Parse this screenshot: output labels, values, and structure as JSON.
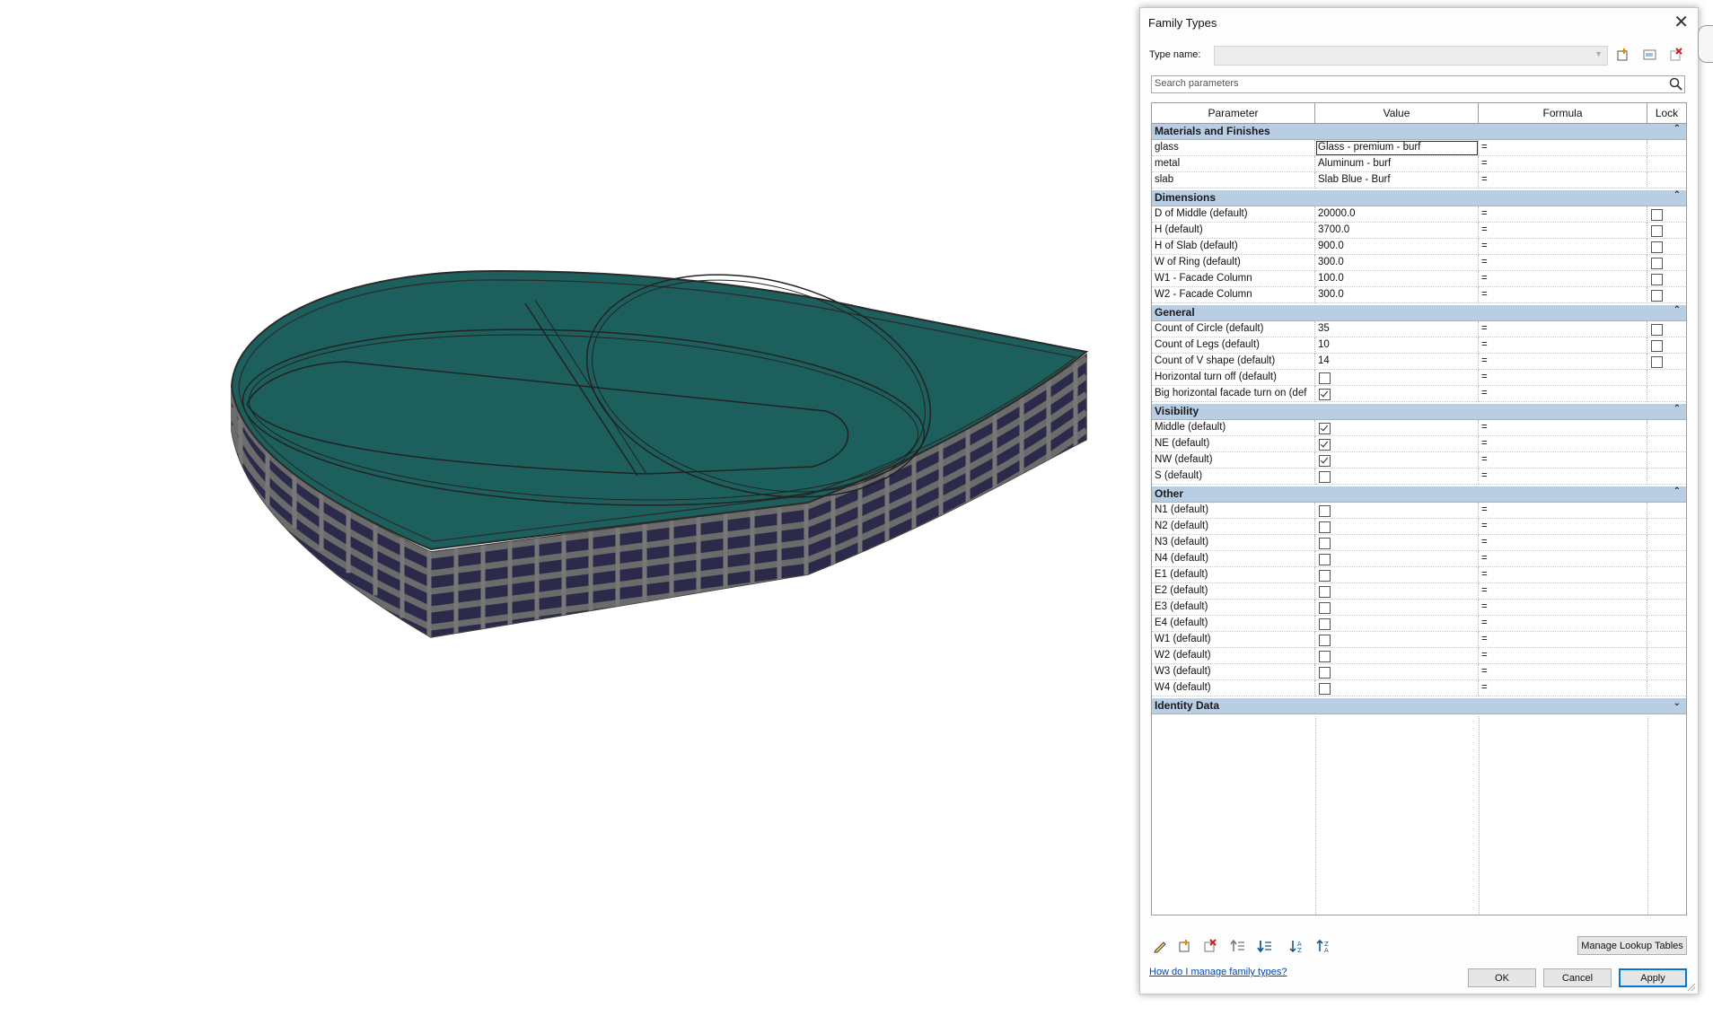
{
  "dialog": {
    "title": "Family Types",
    "type_name_label": "Type name:",
    "type_name_value": "",
    "search_placeholder": "Search parameters",
    "columns": [
      "Parameter",
      "Value",
      "Formula",
      "Lock"
    ],
    "groups": [
      {
        "name": "Materials and Finishes",
        "collapse_glyph": "⌃",
        "rows": [
          {
            "param": "glass",
            "value": "Glass - premium - burf",
            "formula": "=",
            "lock": null,
            "editing": true
          },
          {
            "param": "metal",
            "value": "Aluminum - burf",
            "formula": "=",
            "lock": null
          },
          {
            "param": "slab",
            "value": "Slab Blue - Burf",
            "formula": "=",
            "lock": null
          }
        ]
      },
      {
        "name": "Dimensions",
        "collapse_glyph": "⌃",
        "rows": [
          {
            "param": "D of Middle (default)",
            "value": "20000.0",
            "formula": "=",
            "lock": false
          },
          {
            "param": "H (default)",
            "value": "3700.0",
            "formula": "=",
            "lock": false
          },
          {
            "param": "H of Slab (default)",
            "value": "900.0",
            "formula": "=",
            "lock": false
          },
          {
            "param": "W of Ring (default)",
            "value": "300.0",
            "formula": "=",
            "lock": false
          },
          {
            "param": "W1 - Facade Column",
            "value": "100.0",
            "formula": "=",
            "lock": false
          },
          {
            "param": "W2 - Facade Column",
            "value": "300.0",
            "formula": "=",
            "lock": false
          }
        ]
      },
      {
        "name": "General",
        "collapse_glyph": "⌃",
        "rows": [
          {
            "param": "Count of Circle (default)",
            "value": "35",
            "formula": "=",
            "lock": false
          },
          {
            "param": "Count of Legs (default)",
            "value": "10",
            "formula": "=",
            "lock": false
          },
          {
            "param": "Count of V shape (default)",
            "value": "14",
            "formula": "=",
            "lock": false
          },
          {
            "param": "Horizontal turn off (default)",
            "check": false,
            "formula": "=",
            "lock": null
          },
          {
            "param": "Big horizontal facade turn on (def",
            "check": true,
            "formula": "=",
            "lock": null
          }
        ]
      },
      {
        "name": "Visibility",
        "collapse_glyph": "⌃",
        "rows": [
          {
            "param": "Middle (default)",
            "check": true,
            "formula": "=",
            "lock": null
          },
          {
            "param": "NE (default)",
            "check": true,
            "formula": "=",
            "lock": null
          },
          {
            "param": "NW (default)",
            "check": true,
            "formula": "=",
            "lock": null
          },
          {
            "param": "S (default)",
            "check": false,
            "formula": "=",
            "lock": null
          }
        ]
      },
      {
        "name": "Other",
        "collapse_glyph": "⌃",
        "rows": [
          {
            "param": "N1 (default)",
            "check": false,
            "formula": "=",
            "lock": null
          },
          {
            "param": "N2 (default)",
            "check": false,
            "formula": "=",
            "lock": null
          },
          {
            "param": "N3 (default)",
            "check": false,
            "formula": "=",
            "lock": null
          },
          {
            "param": "N4 (default)",
            "check": false,
            "formula": "=",
            "lock": null
          },
          {
            "param": "E1 (default)",
            "check": false,
            "formula": "=",
            "lock": null
          },
          {
            "param": "E2 (default)",
            "check": false,
            "formula": "=",
            "lock": null
          },
          {
            "param": "E3 (default)",
            "check": false,
            "formula": "=",
            "lock": null
          },
          {
            "param": "E4 (default)",
            "check": false,
            "formula": "=",
            "lock": null
          },
          {
            "param": "W1 (default)",
            "check": false,
            "formula": "=",
            "lock": null
          },
          {
            "param": "W2 (default)",
            "check": false,
            "formula": "=",
            "lock": null
          },
          {
            "param": "W3 (default)",
            "check": false,
            "formula": "=",
            "lock": null
          },
          {
            "param": "W4 (default)",
            "check": false,
            "formula": "=",
            "lock": null
          }
        ]
      },
      {
        "name": "Identity Data",
        "collapse_glyph": "⌄",
        "rows": []
      }
    ],
    "bottom_toolbar_icons": [
      "edit-pencil-icon",
      "new-parameter-icon",
      "delete-parameter-icon",
      "move-up-icon",
      "move-down-icon",
      "sort-ascending-icon",
      "sort-descending-icon"
    ],
    "manage_lookup_label": "Manage Lookup Tables",
    "help_link": "How do I manage family types?",
    "ok_label": "OK",
    "cancel_label": "Cancel",
    "apply_label": "Apply"
  },
  "colors": {
    "group_header": "#b9cde3",
    "roof": "#1d5f5c",
    "glass": "#2b2a4a",
    "frame": "#5f5f5f",
    "link": "#0645ad",
    "apply_border": "#0078d7"
  }
}
